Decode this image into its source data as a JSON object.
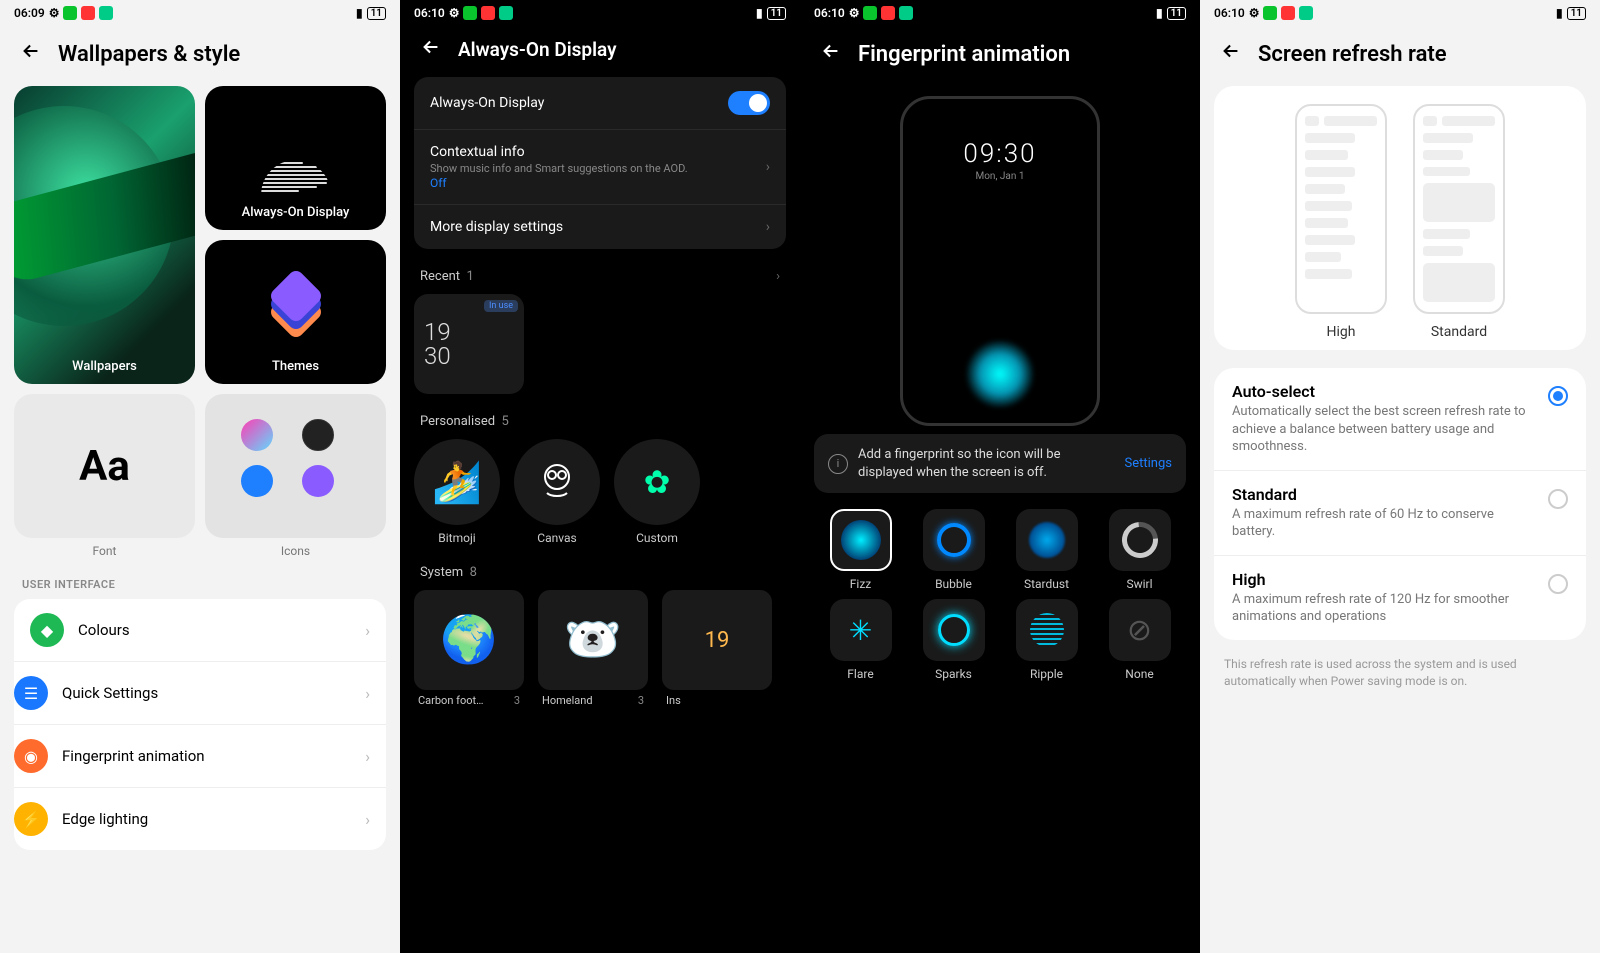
{
  "statusbar": {
    "time_0609": "06:09",
    "time_0610": "06:10",
    "batt": "11"
  },
  "screen1": {
    "title": "Wallpapers & style",
    "wallpapers": "Wallpapers",
    "aod": "Always-On Display",
    "themes": "Themes",
    "font": "Font",
    "icons": "Icons",
    "font_Aa": "Aa",
    "section": "USER INTERFACE",
    "items": {
      "colours": "Colours",
      "quick": "Quick Settings",
      "fp": "Fingerprint animation",
      "edge": "Edge lighting"
    }
  },
  "screen2": {
    "title": "Always-On Display",
    "row_aod": "Always-On Display",
    "row_ctx_t": "Contextual info",
    "row_ctx_s": "Show music info and Smart suggestions on the AOD.",
    "row_ctx_v": "Off",
    "row_more": "More display settings",
    "recent_label": "Recent",
    "recent_count": "1",
    "badge_inuse": "In use",
    "recent_time_top": "19",
    "recent_time_bottom": "30",
    "pers_label": "Personalised",
    "pers_count": "5",
    "pers_items": {
      "bitmoji": "Bitmoji",
      "canvas": "Canvas",
      "custom": "Custom"
    },
    "sys_label": "System",
    "sys_count": "8",
    "sys": {
      "carbon": "Carbon foot…",
      "carbon_n": "3",
      "homeland": "Homeland",
      "homeland_n": "3",
      "ins": "Ins",
      "clock19": "19"
    }
  },
  "screen3": {
    "title": "Fingerprint animation",
    "mock_time": "09:30",
    "mock_date": "Mon, Jan 1",
    "banner": "Add a fingerprint so the icon will be displayed when the screen is off.",
    "banner_link": "Settings",
    "anim": {
      "fizz": "Fizz",
      "bubble": "Bubble",
      "stardust": "Stardust",
      "swirl": "Swirl",
      "flare": "Flare",
      "sparks": "Sparks",
      "ripple": "Ripple",
      "none": "None"
    }
  },
  "screen4": {
    "title": "Screen refresh rate",
    "tab_high": "High",
    "tab_std": "Standard",
    "opts": {
      "auto_t": "Auto-select",
      "auto_d": "Automatically select the best screen refresh rate to achieve a balance between battery usage and smoothness.",
      "std_t": "Standard",
      "std_d": "A maximum refresh rate of 60 Hz to conserve battery.",
      "high_t": "High",
      "high_d": "A maximum refresh rate of 120 Hz for smoother animations and operations"
    },
    "footnote": "This refresh rate is used across the system and is used automatically when Power saving mode is on."
  }
}
